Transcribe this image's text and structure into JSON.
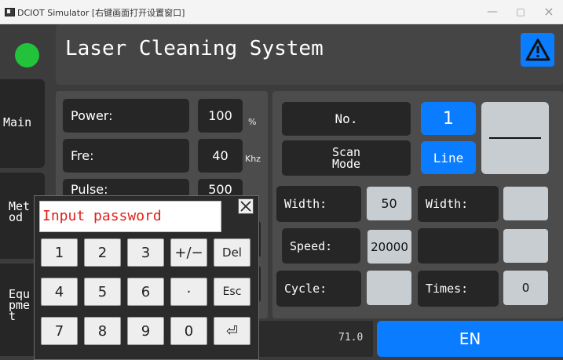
{
  "window": {
    "title": "DCIOT Simulator [右键画面打开设置窗口]",
    "minimize": "—",
    "maximize": "□",
    "close": "×"
  },
  "header": {
    "title": "Laser Cleaning System",
    "warning_icon": "warning-triangle-icon"
  },
  "colors": {
    "accent": "#0a7cff",
    "background": "#3c3c3c",
    "panel": "#4c4c4c",
    "field": "#262626",
    "status_led": "#22c33a",
    "input_text": "#e0201a"
  },
  "sidebar": {
    "items": [
      {
        "label": "Main"
      },
      {
        "label": "Met\nod"
      },
      {
        "label": "Equ\npme\nt"
      }
    ]
  },
  "params": {
    "power": {
      "label": "Power:",
      "value": "100",
      "unit": "%"
    },
    "freq": {
      "label": "Fre:",
      "value": "40",
      "unit": "Khz"
    },
    "pulse": {
      "label": "Pulse:",
      "value": "500"
    }
  },
  "mode": {
    "no_label": "No.",
    "no_value": "1",
    "scan_mode_label": "Scan\nMode",
    "scan_mode_value": "Line",
    "width_label": "Width:",
    "width_value": "50",
    "width2_label": "Width:",
    "width2_value": "",
    "speed_label": "Speed:",
    "speed_value": "20000",
    "cycle_label": "Cycle:",
    "cycle_value": "",
    "times_label": "Times:",
    "times_value": "0"
  },
  "footer": {
    "reading": "71.0",
    "lang_button": "EN"
  },
  "keypad": {
    "placeholder": "Input password",
    "close_icon": "close-x-icon",
    "keys": [
      [
        "1",
        "2",
        "3",
        "+/−",
        "Del"
      ],
      [
        "4",
        "5",
        "6",
        "·",
        "Esc"
      ],
      [
        "7",
        "8",
        "9",
        "0",
        "⏎"
      ]
    ]
  }
}
